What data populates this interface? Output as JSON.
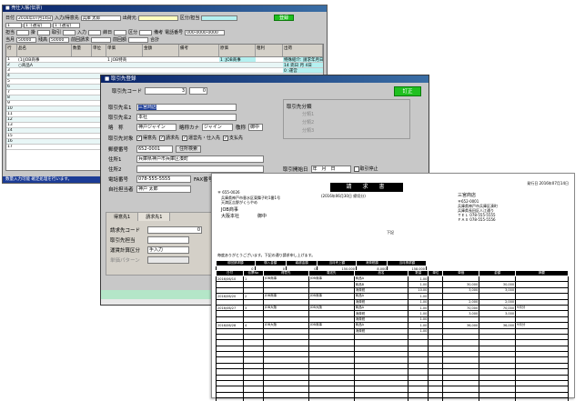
{
  "slip_window": {
    "title": "■ 売仕入帳(伝票)",
    "top_row": {
      "date_label": "日付",
      "date_value": "2016年07月14日",
      "customer_label": "入力/得意先",
      "customer_value": "兵庫 太郎",
      "delivery_label": "出荷元",
      "kbn_label": "区分/担当",
      "btn": "登録"
    },
    "second_row": [
      "1",
      "1 :(通常)",
      "1 :(通常)"
    ],
    "meta_row": [
      "担当",
      "掛",
      "取引",
      "入力",
      "締日",
      "区分",
      "備考",
      "電話番号",
      "000-0000-0000"
    ],
    "meta_row2": [
      "当月",
      "50000",
      "残高",
      "50000",
      "前回請求",
      "前回額",
      "合計"
    ],
    "grid_headers": [
      "行",
      "品名",
      "数量",
      "単位",
      "単価",
      "金額",
      "備考",
      "原価",
      "粗利",
      "出荷"
    ],
    "grid_rows": [
      [
        "1",
        "(1)JOB商事",
        "",
        "",
        "1 JOB特商",
        "",
        "",
        "1 :JOB商事",
        "",
        "特殊紹介: 請求年月日"
      ],
      [
        "2",
        "○商品A",
        "",
        "",
        "",
        "",
        "",
        "",
        "",
        "14 売日 月 4日"
      ],
      [
        "3",
        "",
        "",
        "",
        "",
        "",
        "",
        "",
        "",
        "0 :運営"
      ],
      [
        "4",
        "",
        "",
        "",
        "",
        "",
        "",
        "",
        "",
        ""
      ],
      [
        "5",
        "",
        "",
        "",
        "",
        "",
        "",
        "",
        "",
        ""
      ],
      [
        "6",
        "",
        "",
        "",
        "",
        "",
        "",
        "",
        "",
        ""
      ],
      [
        "7",
        "",
        "",
        "",
        "",
        "",
        "",
        "",
        "",
        ""
      ],
      [
        "8",
        "",
        "",
        "",
        "",
        "",
        "",
        "",
        "",
        ""
      ],
      [
        "9",
        "",
        "",
        "",
        "",
        "",
        "",
        "",
        "",
        ""
      ],
      [
        "10",
        "",
        "",
        "",
        "",
        "",
        "",
        "",
        "",
        ""
      ],
      [
        "11",
        "",
        "",
        "",
        "",
        "",
        "",
        "",
        "",
        ""
      ],
      [
        "12",
        "",
        "",
        "",
        "",
        "",
        "",
        "",
        "",
        ""
      ],
      [
        "13",
        "",
        "",
        "",
        "",
        "",
        "",
        "",
        "",
        ""
      ],
      [
        "14",
        "",
        "",
        "",
        "",
        "",
        "",
        "",
        "",
        ""
      ],
      [
        "15",
        "",
        "",
        "",
        "",
        "",
        "",
        "",
        "",
        ""
      ],
      [
        "16",
        "",
        "",
        "",
        "",
        "",
        "",
        "",
        "",
        ""
      ],
      [
        "17",
        "",
        "",
        "",
        "",
        "",
        "",
        "",
        "",
        ""
      ]
    ],
    "status_text": "数量入力可能 確定処理を行います。"
  },
  "customer_window": {
    "title": "■ 取引先登録",
    "code_label": "取引先コード",
    "code_value": "3",
    "code_sub": "0",
    "btn_teisei": "訂正",
    "name1_label": "取引先名1",
    "name1_value": "三宮商店",
    "name2_label": "取引先名2",
    "name2_value": "本社",
    "short_label": "略　称",
    "short_value": "神戸ジャイン",
    "kana_label": "略称カナ",
    "kana_value": "ジャイン",
    "pref_label": "敬称",
    "pref_value": "御中",
    "target_label": "取引先対象",
    "checks": [
      "得意先",
      "請求先",
      "運営先・仕入先",
      "支払先"
    ],
    "postal_label": "郵便番号",
    "postal_value": "652-0001",
    "postal_btn": "住所検索",
    "addr1_label": "住所1",
    "addr1_value": "兵庫県神戸市兵庫区湊町",
    "addr2_label": "住所2",
    "phone_label": "電話番号",
    "phone_value": "078-555-5555",
    "fax_label": "FAX番号",
    "person_label": "自社担当者",
    "person_value": "神戸 太郎",
    "category_label": "取引先分類",
    "category_items": [
      "分類1",
      "分類2",
      "分類3"
    ],
    "start_label": "取引開始日",
    "start_value": "年　月　日",
    "stop_label": "取引停止",
    "tabs": [
      "得意先1",
      "請求先1"
    ],
    "invoice_code_label": "請求先コード",
    "invoice_code_value": "0",
    "tanto_label": "取引先担当",
    "calc_label": "運賃計算区分",
    "calc_value": "手入力",
    "memo_label": "単価パターン"
  },
  "invoice": {
    "title": "請　求　書",
    "issue_date": "発行日 2016年07月14日",
    "post": "〒 655-0026",
    "addr_lines": [
      "兵庫県神戸市垂水区東舞子町1番1号",
      "天満区吉野がくらやめ"
    ],
    "to_company": "JOB商事",
    "to_branch": "大阪本社",
    "to_suffix": "御中",
    "period": "(2016年06月30日 締切分)",
    "from_company": "三宮商店",
    "from_lines": [
      "〒652-0001",
      "兵庫県神戸市兵庫区湊町",
      "兵庫県長田区人江通り",
      "ＴＥＬ 078-555-5555",
      "ＦＡＸ 078-555-5556"
    ],
    "greeting": "毎度ありがとうございます。下記の通り請求申し上げます。",
    "note": "下記",
    "sum_headers": [
      "前回請求額",
      "御入金額",
      "繰越金額",
      "当月売上額",
      "消費税額",
      "当月請求額"
    ],
    "sum_values": [
      "0",
      "0",
      "0",
      "150,000",
      "8,000",
      "158,000"
    ],
    "detail_headers": [
      "日付",
      "伝票No",
      "得意先",
      "運送先",
      "品名",
      "数量",
      "単位",
      "単価",
      "金額",
      "摘要"
    ],
    "detail_rows": [
      [
        "2016/06/10",
        "1",
        "JOB商事",
        "JOB商事",
        "商品A",
        "1.00",
        "",
        "",
        "",
        ""
      ],
      [
        "",
        "",
        "",
        "",
        "商品B",
        "1.00",
        "",
        "30,000",
        "30,000",
        ""
      ],
      [
        "",
        "",
        "",
        "",
        "消費税",
        "10.00",
        "",
        "3,000",
        "3,000",
        ""
      ],
      [
        "2016/06/20",
        "2",
        "JOB商事",
        "JOB商事",
        "商品A",
        "1.00",
        "",
        "",
        "",
        ""
      ],
      [
        "",
        "",
        "",
        "",
        "消費税",
        "1.00",
        "",
        "2,000",
        "2,000",
        ""
      ],
      [
        "2016/06/27",
        "3",
        "JOB大阪",
        "JOB大阪",
        "商品A",
        "1.00",
        "",
        "70,000",
        "70,000",
        "9月分"
      ],
      [
        "",
        "",
        "",
        "",
        "消費税",
        "1.00",
        "",
        "3,000",
        "3,000",
        ""
      ],
      [
        "",
        "",
        "",
        "",
        "消費税",
        "1.00",
        "",
        "",
        "",
        ""
      ],
      [
        "2016/06/28",
        "4",
        "JOB大阪",
        "JOB商事",
        "商品A",
        "1.00",
        "",
        "36,000",
        "36,000",
        "9月分"
      ],
      [
        "",
        "",
        "",
        "",
        "消費税",
        "1.00",
        "",
        "",
        "",
        ""
      ]
    ],
    "empty_rows": 14
  },
  "colors": {
    "titlebar": "#0a246a",
    "accent_green": "#20c020",
    "cyan": "#b4f0f0",
    "invoice_header": "#000000"
  }
}
